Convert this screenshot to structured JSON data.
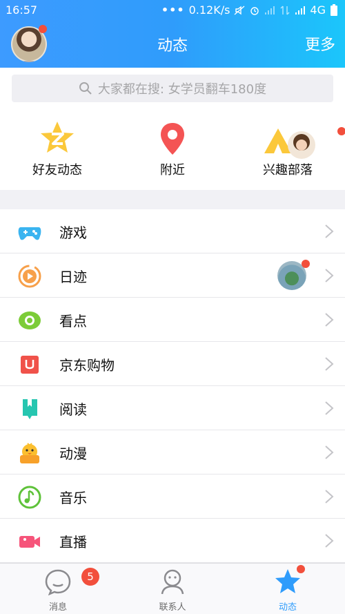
{
  "status_bar": {
    "time": "16:57",
    "net_speed": "0.12K/s",
    "network": "4G"
  },
  "header": {
    "title": "动态",
    "more_label": "更多"
  },
  "search": {
    "placeholder": "大家都在搜: 女学员翻车180度"
  },
  "quick_entries": [
    {
      "label": "好友动态",
      "icon": "friends-star-icon"
    },
    {
      "label": "附近",
      "icon": "location-pin-icon"
    },
    {
      "label": "兴趣部落",
      "icon": "tribe-tent-icon"
    }
  ],
  "list_items": [
    {
      "label": "游戏",
      "icon": "gamepad-icon"
    },
    {
      "label": "日迹",
      "icon": "play-circle-icon"
    },
    {
      "label": "看点",
      "icon": "eye-icon"
    },
    {
      "label": "京东购物",
      "icon": "shopping-bag-icon"
    },
    {
      "label": "阅读",
      "icon": "book-icon"
    },
    {
      "label": "动漫",
      "icon": "chick-icon"
    },
    {
      "label": "音乐",
      "icon": "music-note-icon"
    },
    {
      "label": "直播",
      "icon": "video-camera-icon"
    }
  ],
  "tabs": [
    {
      "label": "消息",
      "badge": "5",
      "icon": "chat-bubble-icon"
    },
    {
      "label": "联系人",
      "icon": "contacts-person-icon"
    },
    {
      "label": "动态",
      "icon": "star-icon"
    }
  ],
  "colors": {
    "accent": "#2f9cfb",
    "badge": "#f24f3c"
  }
}
